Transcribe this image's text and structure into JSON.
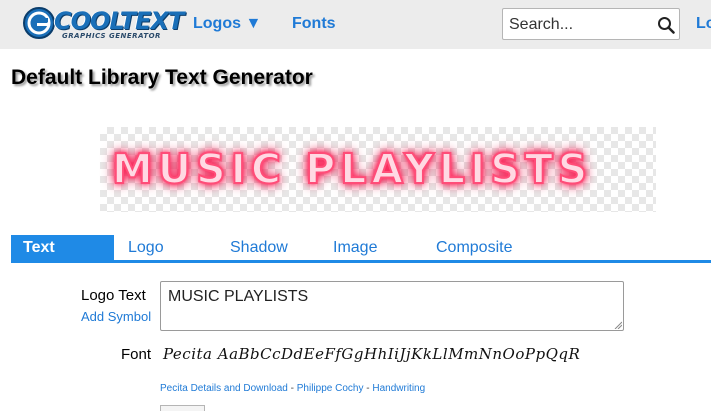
{
  "header": {
    "brand_main": "COOLTEXT",
    "brand_sub": "GRAPHICS GENERATOR",
    "nav": {
      "logos": "Logos ▼",
      "fonts": "Fonts",
      "login": "Lo"
    },
    "search": {
      "placeholder": "Search...",
      "icon": "search-icon"
    }
  },
  "page": {
    "title": "Default Library Text Generator"
  },
  "preview": {
    "text": "MUSIC PLAYLISTS",
    "glow_color": "#ff1f55"
  },
  "tabs": {
    "active": "Text",
    "items": {
      "text": "Text",
      "logo": "Logo",
      "shadow": "Shadow",
      "image": "Image",
      "composite": "Composite"
    }
  },
  "form": {
    "logo_text_label": "Logo Text",
    "add_symbol": "Add Symbol",
    "logo_text_value": "MUSIC PLAYLISTS",
    "font_label": "Font",
    "font_sample": "Pecita AaBbCcDdEeFfGgHhIiJjKkLlMmNnOoPpQqR",
    "font_details_link": "Pecita Details and Download",
    "font_separator": " - ",
    "font_author": "Philippe Cochy",
    "font_category": "Handwriting"
  },
  "colors": {
    "accent": "#1f8ae6",
    "link": "#1f7ad6",
    "topbar": "#ececec"
  }
}
